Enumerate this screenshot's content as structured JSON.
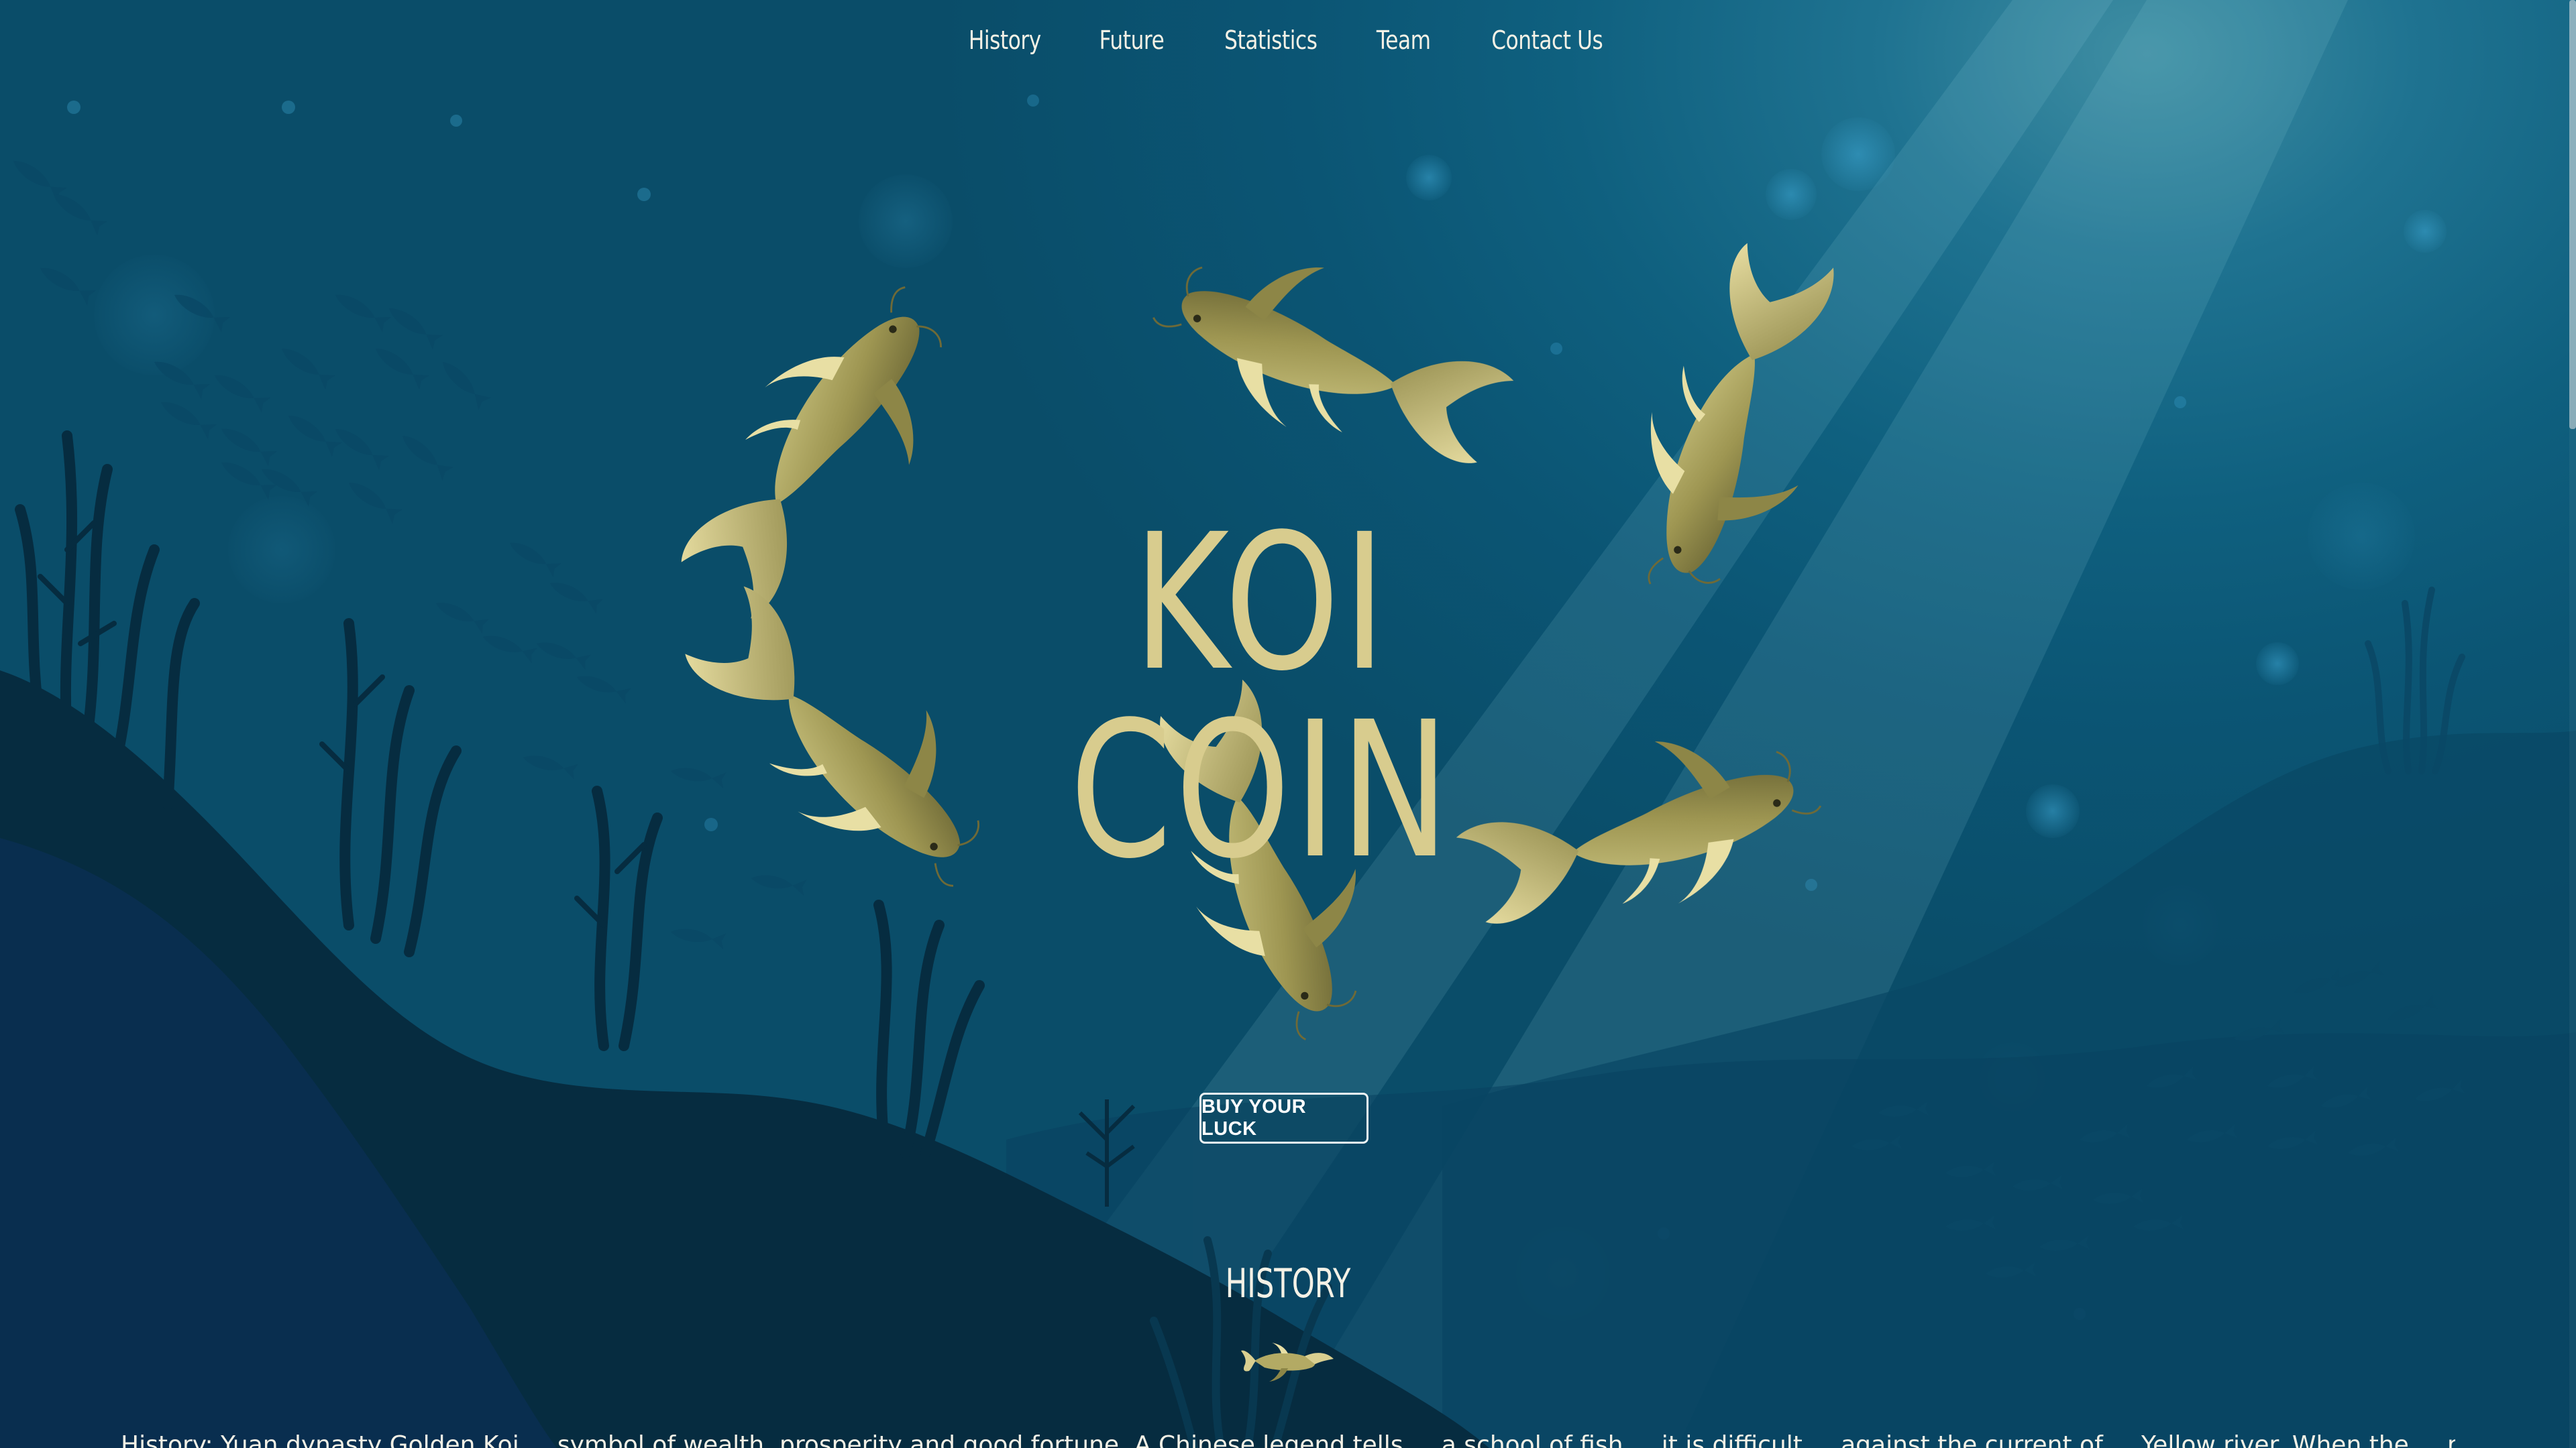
{
  "nav": {
    "items": [
      {
        "label": "History"
      },
      {
        "label": "Future"
      },
      {
        "label": "Statistics"
      },
      {
        "label": "Team"
      },
      {
        "label": "Contact Us"
      }
    ]
  },
  "hero": {
    "title": "KOI COIN",
    "cta_label": "BUY YOUR LUCK"
  },
  "history": {
    "title": "HISTORY",
    "body_preview": "History: Yuan dynasty Golden Koi ... symbol of wealth, prosperity and good fortune. A Chinese legend tells ... a school of fish ... it is difficult ... against the current of ... Yellow river. When the ... reached the waterfall, many of the ..."
  },
  "colors": {
    "background": "#0b5574",
    "koi_gold": "#d8cc8e",
    "koi_body": "#a8a15c",
    "silhouette": "#062c40",
    "nav_text": "#f4f1e6"
  }
}
